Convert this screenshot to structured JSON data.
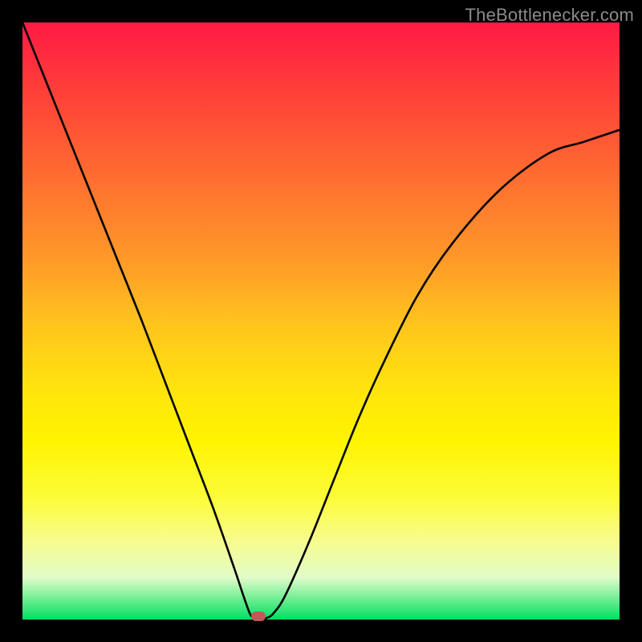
{
  "watermark": {
    "text": "TheBottlenecker.com"
  },
  "chart_data": {
    "type": "line",
    "title": "",
    "xlabel": "",
    "ylabel": "",
    "xlim": [
      0,
      1
    ],
    "ylim": [
      0,
      1
    ],
    "grid": false,
    "legend": false,
    "background_gradient": {
      "top": "#ff1a44",
      "middle": "#ffe010",
      "bottom": "#00e060"
    },
    "series": [
      {
        "name": "curve",
        "type": "line",
        "color": "#000000",
        "x": [
          0.0,
          0.04,
          0.08,
          0.12,
          0.16,
          0.2,
          0.24,
          0.28,
          0.32,
          0.355,
          0.37,
          0.38,
          0.385,
          0.39,
          0.395,
          0.4,
          0.41,
          0.42,
          0.44,
          0.48,
          0.52,
          0.56,
          0.6,
          0.66,
          0.72,
          0.8,
          0.88,
          0.94,
          1.0
        ],
        "values": [
          1.0,
          0.9,
          0.8,
          0.7,
          0.6,
          0.5,
          0.395,
          0.29,
          0.185,
          0.085,
          0.04,
          0.012,
          0.004,
          0.001,
          0.001,
          0.0,
          0.003,
          0.01,
          0.04,
          0.13,
          0.23,
          0.33,
          0.42,
          0.54,
          0.63,
          0.72,
          0.78,
          0.8,
          0.82
        ]
      }
    ],
    "marker": {
      "x": 0.395,
      "y": 0.005,
      "color": "#c05a5a",
      "shape": "rounded-rect"
    }
  }
}
